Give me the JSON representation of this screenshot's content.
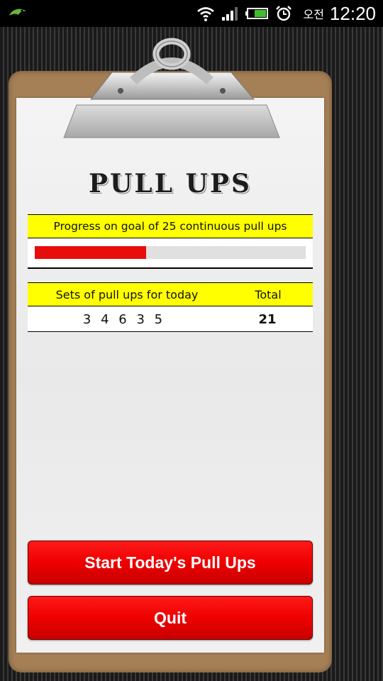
{
  "status_bar": {
    "ampm": "오전",
    "time": "12:20"
  },
  "title": "PULL UPS",
  "progress": {
    "label": "Progress on goal of 25 continuous pull ups",
    "fraction": 0.41,
    "fill_color": "#e80c0c"
  },
  "sets": {
    "header_label": "Sets of pull ups for today",
    "total_label": "Total",
    "values": "3 4 6 3 5",
    "total": "21"
  },
  "buttons": {
    "start_label": "Start Today's Pull Ups",
    "quit_label": "Quit"
  },
  "colors": {
    "header_yellow": "#ffff00",
    "button_red": "#ee0000",
    "board_brown": "#a57f55"
  },
  "icons": [
    "app-notification-icon",
    "wifi-icon",
    "signal-icon",
    "battery-icon",
    "alarm-icon"
  ]
}
